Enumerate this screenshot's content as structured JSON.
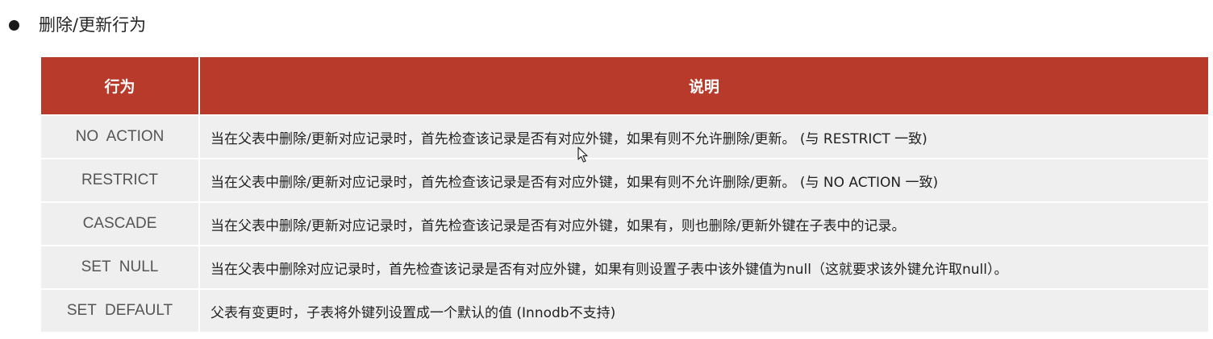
{
  "heading": "删除/更新行为",
  "table": {
    "headers": [
      "行为",
      "说明"
    ],
    "rows": [
      {
        "action": "NO  ACTION",
        "description": "当在父表中删除/更新对应记录时，首先检查该记录是否有对应外键，如果有则不允许删除/更新。 (与 RESTRICT 一致)"
      },
      {
        "action": "RESTRICT",
        "description": "当在父表中删除/更新对应记录时，首先检查该记录是否有对应外键，如果有则不允许删除/更新。 (与 NO ACTION 一致)"
      },
      {
        "action": "CASCADE",
        "description": "当在父表中删除/更新对应记录时，首先检查该记录是否有对应外键，如果有，则也删除/更新外键在子表中的记录。"
      },
      {
        "action": "SET  NULL",
        "description": "当在父表中删除对应记录时，首先检查该记录是否有对应外键，如果有则设置子表中该外键值为null（这就要求该外键允许取null）。"
      },
      {
        "action": "SET  DEFAULT",
        "description": "父表有变更时，子表将外键列设置成一个默认的值 (Innodb不支持)"
      }
    ]
  },
  "colors": {
    "header_bg": "#b83a2b",
    "row_bg": "#efefef"
  }
}
